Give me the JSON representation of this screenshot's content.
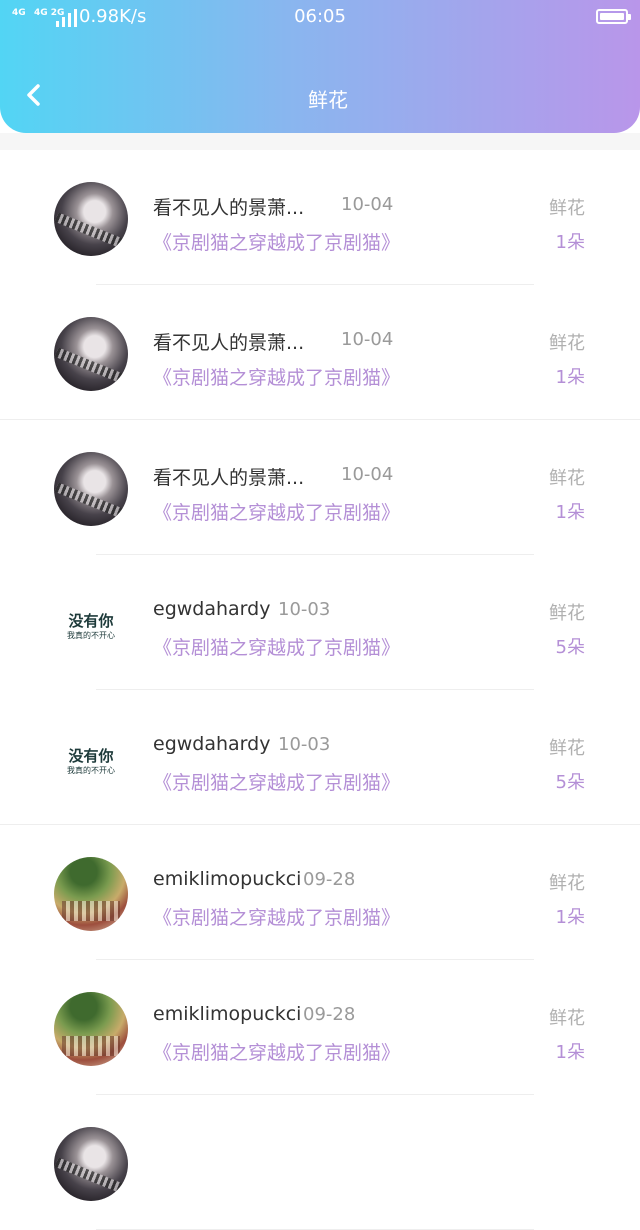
{
  "status_bar": {
    "signal_a": "4G",
    "signal_b": "4G 2G",
    "net_speed": "0.98K/s",
    "time": "06:05",
    "battery_icon": "battery-full-icon"
  },
  "header": {
    "title": "鲜花",
    "back_icon": "chevron-left-icon"
  },
  "rows": [
    {
      "avatar_style": "dark",
      "name": "看不见人的景萧...",
      "date": "10-04",
      "book": "《京剧猫之穿越成了京剧猫》",
      "gift_type": "鲜花",
      "count": "1朵"
    },
    {
      "avatar_style": "dark",
      "name": "看不见人的景萧...",
      "date": "10-04",
      "book": "《京剧猫之穿越成了京剧猫》",
      "gift_type": "鲜花",
      "count": "1朵"
    },
    {
      "avatar_style": "dark",
      "name": "看不见人的景萧...",
      "date": "10-04",
      "book": "《京剧猫之穿越成了京剧猫》",
      "gift_type": "鲜花",
      "count": "1朵"
    },
    {
      "avatar_style": "text",
      "avatar_text_main": "没有你",
      "avatar_text_sub": "我真的不开心",
      "name": "egwdahardy",
      "date": "10-03",
      "book": "《京剧猫之穿越成了京剧猫》",
      "gift_type": "鲜花",
      "count": "5朵"
    },
    {
      "avatar_style": "text",
      "avatar_text_main": "没有你",
      "avatar_text_sub": "我真的不开心",
      "name": "egwdahardy",
      "date": "10-03",
      "book": "《京剧猫之穿越成了京剧猫》",
      "gift_type": "鲜花",
      "count": "5朵"
    },
    {
      "avatar_style": "scene",
      "name": "emiklimopuckci",
      "date": "09-28",
      "book": "《京剧猫之穿越成了京剧猫》",
      "gift_type": "鲜花",
      "count": "1朵"
    },
    {
      "avatar_style": "scene",
      "name": "emiklimopuckci",
      "date": "09-28",
      "book": "《京剧猫之穿越成了京剧猫》",
      "gift_type": "鲜花",
      "count": "1朵"
    },
    {
      "avatar_style": "dark",
      "name": "",
      "date": "",
      "book": "",
      "gift_type": "",
      "count": ""
    }
  ],
  "colors": {
    "gradient_start": "#52d5f4",
    "gradient_end": "#b996ea",
    "accent_purple": "#b48fd6",
    "muted_gray": "#9a9a9a"
  }
}
